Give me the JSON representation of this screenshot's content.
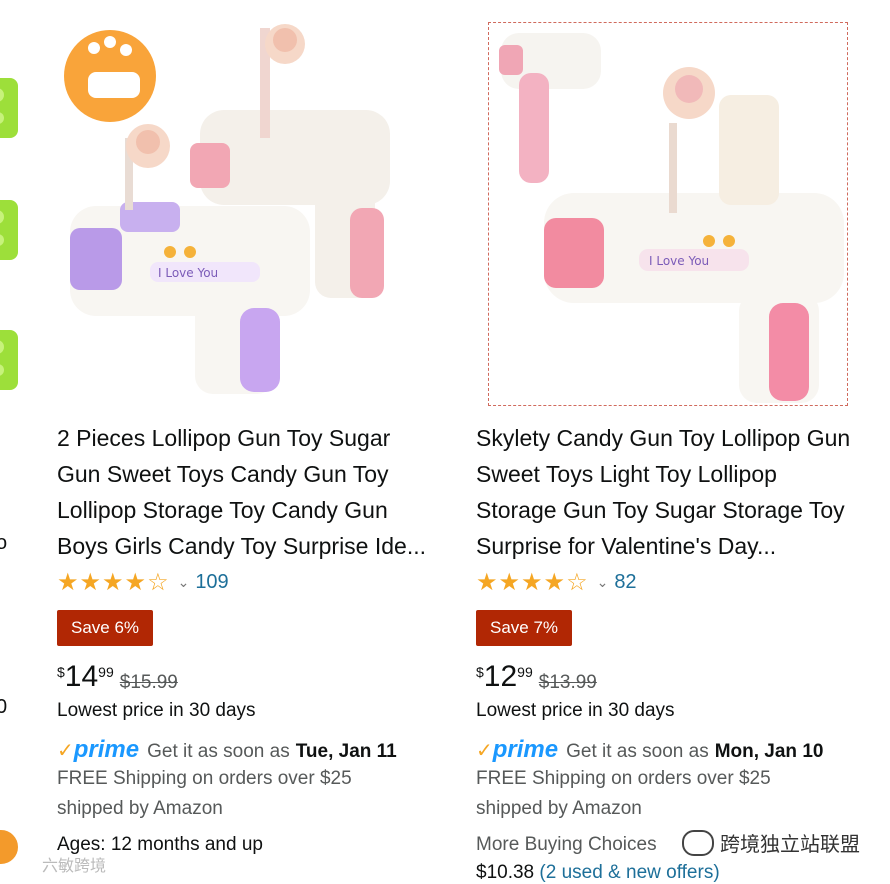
{
  "left_column": {
    "partial_chars": [
      "o",
      ".",
      "0"
    ]
  },
  "products": [
    {
      "image_label": "I Love You",
      "title": "2 Pieces Lollipop Gun Toy Sugar Gun Sweet Toys Candy Gun Toy Lollipop Storage Toy Candy Gun Boys Girls Candy Toy Surprise Ide...",
      "stars": "★★★★☆",
      "rating_count": "109",
      "save_badge": "Save 6%",
      "price_symbol": "$",
      "price_whole": "14",
      "price_fraction": "99",
      "list_price": "$15.99",
      "lowest_price": "Lowest price in 30 days",
      "prime_label": "prime",
      "get_it": "Get it as soon as",
      "delivery_date": "Tue, Jan 11",
      "free_shipping": "FREE Shipping on orders over $25",
      "shipped_by": "shipped by Amazon",
      "ages": "Ages: 12 months and up"
    },
    {
      "image_label": "I Love You",
      "title": "Skylety Candy Gun Toy Lollipop Gun Sweet Toys Light Toy Lollipop Storage Gun Toy Sugar Storage Toy Surprise for Valentine's Day...",
      "stars": "★★★★☆",
      "rating_count": "82",
      "save_badge": "Save 7%",
      "price_symbol": "$",
      "price_whole": "12",
      "price_fraction": "99",
      "list_price": "$13.99",
      "lowest_price": "Lowest price in 30 days",
      "prime_label": "prime",
      "get_it": "Get it as soon as",
      "delivery_date": "Mon, Jan 10",
      "free_shipping": "FREE Shipping on orders over $25",
      "shipped_by": "shipped by Amazon",
      "more_buying": "More Buying Choices",
      "more_price": "$10.38",
      "more_offers": "(2 used & new offers)"
    }
  ],
  "watermark": {
    "text": "跨境独立站联盟",
    "subtext": "六敏跨境"
  },
  "colors": {
    "save_badge": "#b12704",
    "star": "#f5a623",
    "link": "#1d6f99",
    "prime": "#1a98ff"
  }
}
